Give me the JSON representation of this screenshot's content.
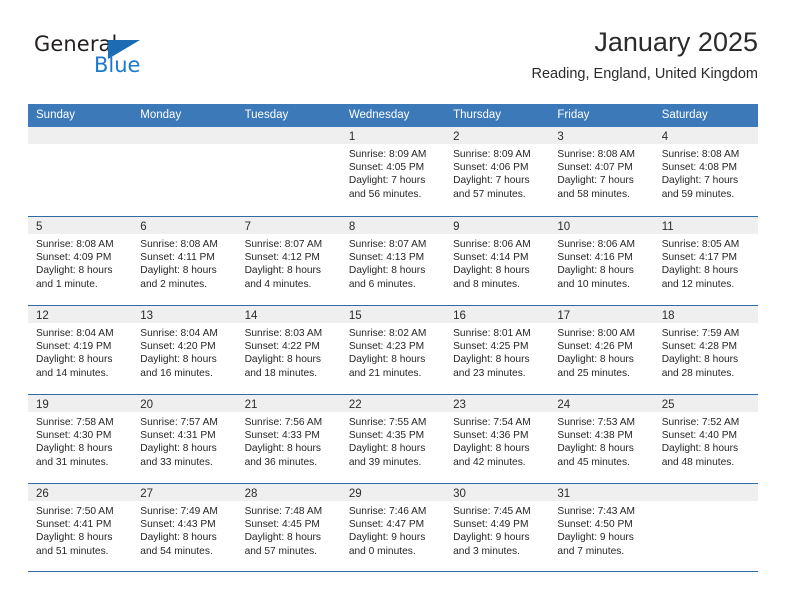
{
  "logo": {
    "word_one": "General",
    "word_two": "Blue",
    "triangle_icon": "triangle-icon",
    "colors": {
      "dark": "#231f20",
      "blue": "#1b79d0",
      "triangle": "#1b6cb3"
    }
  },
  "header": {
    "title": "January 2025",
    "location": "Reading, England, United Kingdom"
  },
  "theme": {
    "header_blue": "#3b79b8",
    "rule_blue": "#2e6ca8",
    "day_band_gray": "#efeff0"
  },
  "calendar": {
    "weekdays": [
      "Sunday",
      "Monday",
      "Tuesday",
      "Wednesday",
      "Thursday",
      "Friday",
      "Saturday"
    ],
    "weeks": [
      [
        {
          "day": "",
          "lines": []
        },
        {
          "day": "",
          "lines": []
        },
        {
          "day": "",
          "lines": []
        },
        {
          "day": "1",
          "lines": [
            "Sunrise: 8:09 AM",
            "Sunset: 4:05 PM",
            "Daylight: 7 hours",
            "and 56 minutes."
          ]
        },
        {
          "day": "2",
          "lines": [
            "Sunrise: 8:09 AM",
            "Sunset: 4:06 PM",
            "Daylight: 7 hours",
            "and 57 minutes."
          ]
        },
        {
          "day": "3",
          "lines": [
            "Sunrise: 8:08 AM",
            "Sunset: 4:07 PM",
            "Daylight: 7 hours",
            "and 58 minutes."
          ]
        },
        {
          "day": "4",
          "lines": [
            "Sunrise: 8:08 AM",
            "Sunset: 4:08 PM",
            "Daylight: 7 hours",
            "and 59 minutes."
          ]
        }
      ],
      [
        {
          "day": "5",
          "lines": [
            "Sunrise: 8:08 AM",
            "Sunset: 4:09 PM",
            "Daylight: 8 hours",
            "and 1 minute."
          ]
        },
        {
          "day": "6",
          "lines": [
            "Sunrise: 8:08 AM",
            "Sunset: 4:11 PM",
            "Daylight: 8 hours",
            "and 2 minutes."
          ]
        },
        {
          "day": "7",
          "lines": [
            "Sunrise: 8:07 AM",
            "Sunset: 4:12 PM",
            "Daylight: 8 hours",
            "and 4 minutes."
          ]
        },
        {
          "day": "8",
          "lines": [
            "Sunrise: 8:07 AM",
            "Sunset: 4:13 PM",
            "Daylight: 8 hours",
            "and 6 minutes."
          ]
        },
        {
          "day": "9",
          "lines": [
            "Sunrise: 8:06 AM",
            "Sunset: 4:14 PM",
            "Daylight: 8 hours",
            "and 8 minutes."
          ]
        },
        {
          "day": "10",
          "lines": [
            "Sunrise: 8:06 AM",
            "Sunset: 4:16 PM",
            "Daylight: 8 hours",
            "and 10 minutes."
          ]
        },
        {
          "day": "11",
          "lines": [
            "Sunrise: 8:05 AM",
            "Sunset: 4:17 PM",
            "Daylight: 8 hours",
            "and 12 minutes."
          ]
        }
      ],
      [
        {
          "day": "12",
          "lines": [
            "Sunrise: 8:04 AM",
            "Sunset: 4:19 PM",
            "Daylight: 8 hours",
            "and 14 minutes."
          ]
        },
        {
          "day": "13",
          "lines": [
            "Sunrise: 8:04 AM",
            "Sunset: 4:20 PM",
            "Daylight: 8 hours",
            "and 16 minutes."
          ]
        },
        {
          "day": "14",
          "lines": [
            "Sunrise: 8:03 AM",
            "Sunset: 4:22 PM",
            "Daylight: 8 hours",
            "and 18 minutes."
          ]
        },
        {
          "day": "15",
          "lines": [
            "Sunrise: 8:02 AM",
            "Sunset: 4:23 PM",
            "Daylight: 8 hours",
            "and 21 minutes."
          ]
        },
        {
          "day": "16",
          "lines": [
            "Sunrise: 8:01 AM",
            "Sunset: 4:25 PM",
            "Daylight: 8 hours",
            "and 23 minutes."
          ]
        },
        {
          "day": "17",
          "lines": [
            "Sunrise: 8:00 AM",
            "Sunset: 4:26 PM",
            "Daylight: 8 hours",
            "and 25 minutes."
          ]
        },
        {
          "day": "18",
          "lines": [
            "Sunrise: 7:59 AM",
            "Sunset: 4:28 PM",
            "Daylight: 8 hours",
            "and 28 minutes."
          ]
        }
      ],
      [
        {
          "day": "19",
          "lines": [
            "Sunrise: 7:58 AM",
            "Sunset: 4:30 PM",
            "Daylight: 8 hours",
            "and 31 minutes."
          ]
        },
        {
          "day": "20",
          "lines": [
            "Sunrise: 7:57 AM",
            "Sunset: 4:31 PM",
            "Daylight: 8 hours",
            "and 33 minutes."
          ]
        },
        {
          "day": "21",
          "lines": [
            "Sunrise: 7:56 AM",
            "Sunset: 4:33 PM",
            "Daylight: 8 hours",
            "and 36 minutes."
          ]
        },
        {
          "day": "22",
          "lines": [
            "Sunrise: 7:55 AM",
            "Sunset: 4:35 PM",
            "Daylight: 8 hours",
            "and 39 minutes."
          ]
        },
        {
          "day": "23",
          "lines": [
            "Sunrise: 7:54 AM",
            "Sunset: 4:36 PM",
            "Daylight: 8 hours",
            "and 42 minutes."
          ]
        },
        {
          "day": "24",
          "lines": [
            "Sunrise: 7:53 AM",
            "Sunset: 4:38 PM",
            "Daylight: 8 hours",
            "and 45 minutes."
          ]
        },
        {
          "day": "25",
          "lines": [
            "Sunrise: 7:52 AM",
            "Sunset: 4:40 PM",
            "Daylight: 8 hours",
            "and 48 minutes."
          ]
        }
      ],
      [
        {
          "day": "26",
          "lines": [
            "Sunrise: 7:50 AM",
            "Sunset: 4:41 PM",
            "Daylight: 8 hours",
            "and 51 minutes."
          ]
        },
        {
          "day": "27",
          "lines": [
            "Sunrise: 7:49 AM",
            "Sunset: 4:43 PM",
            "Daylight: 8 hours",
            "and 54 minutes."
          ]
        },
        {
          "day": "28",
          "lines": [
            "Sunrise: 7:48 AM",
            "Sunset: 4:45 PM",
            "Daylight: 8 hours",
            "and 57 minutes."
          ]
        },
        {
          "day": "29",
          "lines": [
            "Sunrise: 7:46 AM",
            "Sunset: 4:47 PM",
            "Daylight: 9 hours",
            "and 0 minutes."
          ]
        },
        {
          "day": "30",
          "lines": [
            "Sunrise: 7:45 AM",
            "Sunset: 4:49 PM",
            "Daylight: 9 hours",
            "and 3 minutes."
          ]
        },
        {
          "day": "31",
          "lines": [
            "Sunrise: 7:43 AM",
            "Sunset: 4:50 PM",
            "Daylight: 9 hours",
            "and 7 minutes."
          ]
        },
        {
          "day": "",
          "lines": []
        }
      ]
    ]
  }
}
